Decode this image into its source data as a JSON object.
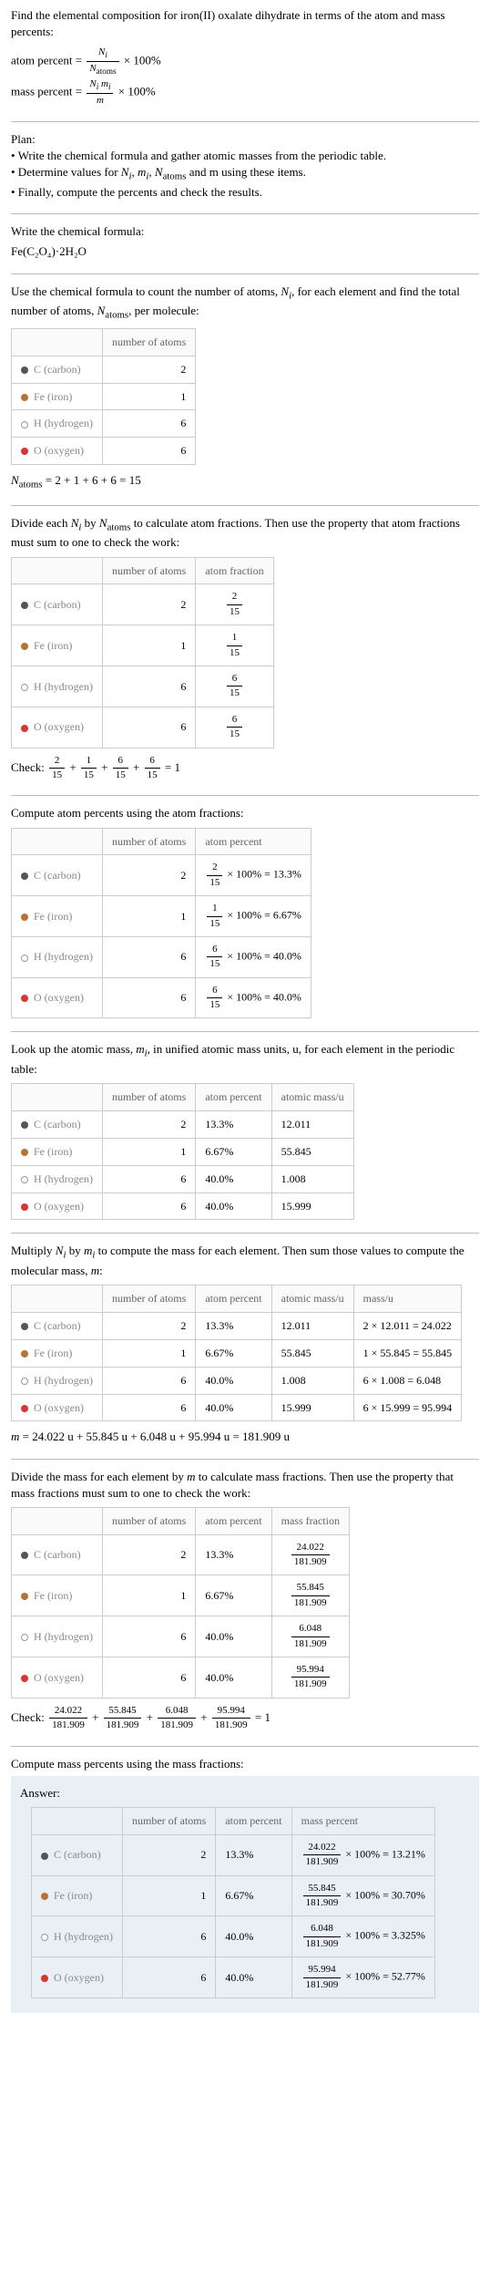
{
  "intro": {
    "line1": "Find the elemental composition for iron(II) oxalate dihydrate in terms of the atom and mass percents:",
    "atomPercentLabel": "atom percent =",
    "atomPercentNum": "N_i",
    "atomPercentDen": "N_atoms",
    "massPercentLabel": "mass percent =",
    "massPercentNum": "N_i m_i",
    "massPercentDen": "m",
    "times100": "× 100%"
  },
  "plan": {
    "heading": "Plan:",
    "bullet1": "• Write the chemical formula and gather atomic masses from the periodic table.",
    "bullet2pre": "• Determine values for ",
    "bullet2vars": "N_i, m_i, N_atoms",
    "bullet2post": " and m using these items.",
    "bullet3": "• Finally, compute the percents and check the results."
  },
  "formula": {
    "heading": "Write the chemical formula:",
    "value": "Fe(C₂O₄)·2H₂O"
  },
  "count": {
    "intro": "Use the chemical formula to count the number of atoms, N_i, for each element and find the total number of atoms, N_atoms, per molecule:",
    "sumLine": "N_atoms = 2 + 1 + 6 + 6 = 15"
  },
  "headers": {
    "numberOfAtoms": "number of atoms",
    "atomFraction": "atom fraction",
    "atomPercent": "atom percent",
    "atomicMass": "atomic mass/u",
    "massU": "mass/u",
    "massFraction": "mass fraction",
    "massPercent": "mass percent"
  },
  "elements": [
    {
      "name": "C (carbon)",
      "color": "c-carbon",
      "n": "2"
    },
    {
      "name": "Fe (iron)",
      "color": "c-iron",
      "n": "1"
    },
    {
      "name": "H (hydrogen)",
      "color": "c-hydrogen",
      "n": "6"
    },
    {
      "name": "O (oxygen)",
      "color": "c-oxygen",
      "n": "6"
    }
  ],
  "atomFractions": {
    "intro": "Divide each N_i by N_atoms to calculate atom fractions. Then use the property that atom fractions must sum to one to check the work:",
    "values": [
      "2/15",
      "1/15",
      "6/15",
      "6/15"
    ],
    "checkLabel": "Check:",
    "checkExpr": "2/15 + 1/15 + 6/15 + 6/15 = 1"
  },
  "atomPercents": {
    "intro": "Compute atom percents using the atom fractions:",
    "rows": [
      {
        "fracN": "2",
        "fracD": "15",
        "pct": "= 13.3%"
      },
      {
        "fracN": "1",
        "fracD": "15",
        "pct": "= 6.67%"
      },
      {
        "fracN": "6",
        "fracD": "15",
        "pct": "= 40.0%"
      },
      {
        "fracN": "6",
        "fracD": "15",
        "pct": "= 40.0%"
      }
    ]
  },
  "atomicMass": {
    "intro": "Look up the atomic mass, m_i, in unified atomic mass units, u, for each element in the periodic table:",
    "percents": [
      "13.3%",
      "6.67%",
      "40.0%",
      "40.0%"
    ],
    "masses": [
      "12.011",
      "55.845",
      "1.008",
      "15.999"
    ]
  },
  "massCalc": {
    "intro": "Multiply N_i by m_i to compute the mass for each element. Then sum those values to compute the molecular mass, m:",
    "rows": [
      {
        "expr": "2 × 12.011 = 24.022"
      },
      {
        "expr": "1 × 55.845 = 55.845"
      },
      {
        "expr": "6 × 1.008 = 6.048"
      },
      {
        "expr": "6 × 15.999 = 95.994"
      }
    ],
    "sumLine": "m = 24.022 u + 55.845 u + 6.048 u + 95.994 u = 181.909 u"
  },
  "massFrac": {
    "intro": "Divide the mass for each element by m to calculate mass fractions. Then use the property that mass fractions must sum to one to check the work:",
    "rows": [
      {
        "num": "24.022",
        "den": "181.909"
      },
      {
        "num": "55.845",
        "den": "181.909"
      },
      {
        "num": "6.048",
        "den": "181.909"
      },
      {
        "num": "95.994",
        "den": "181.909"
      }
    ],
    "checkLabel": "Check:",
    "checkExpr": " 24.022/181.909 + 55.845/181.909 + 6.048/181.909 + 95.994/181.909 = 1"
  },
  "massPct": {
    "intro": "Compute mass percents using the mass fractions:"
  },
  "answer": {
    "label": "Answer:",
    "rows": [
      {
        "num": "24.022",
        "den": "181.909",
        "pct": "= 13.21%"
      },
      {
        "num": "55.845",
        "den": "181.909",
        "pct": "= 30.70%"
      },
      {
        "num": "6.048",
        "den": "181.909",
        "pct": "= 3.325%"
      },
      {
        "num": "95.994",
        "den": "181.909",
        "pct": "= 52.77%"
      }
    ]
  },
  "chart_data": {
    "type": "table",
    "title": "Elemental composition of iron(II) oxalate dihydrate",
    "elements": [
      {
        "element": "C",
        "name": "carbon",
        "n_atoms": 2,
        "atom_fraction": "2/15",
        "atom_percent": 13.3,
        "atomic_mass_u": 12.011,
        "mass_u": 24.022,
        "mass_fraction": "24.022/181.909",
        "mass_percent": 13.21
      },
      {
        "element": "Fe",
        "name": "iron",
        "n_atoms": 1,
        "atom_fraction": "1/15",
        "atom_percent": 6.67,
        "atomic_mass_u": 55.845,
        "mass_u": 55.845,
        "mass_fraction": "55.845/181.909",
        "mass_percent": 30.7
      },
      {
        "element": "H",
        "name": "hydrogen",
        "n_atoms": 6,
        "atom_fraction": "6/15",
        "atom_percent": 40.0,
        "atomic_mass_u": 1.008,
        "mass_u": 6.048,
        "mass_fraction": "6.048/181.909",
        "mass_percent": 3.325
      },
      {
        "element": "O",
        "name": "oxygen",
        "n_atoms": 6,
        "atom_fraction": "6/15",
        "atom_percent": 40.0,
        "atomic_mass_u": 15.999,
        "mass_u": 95.994,
        "mass_fraction": "95.994/181.909",
        "mass_percent": 52.77
      }
    ],
    "N_atoms": 15,
    "molecular_mass_u": 181.909
  }
}
